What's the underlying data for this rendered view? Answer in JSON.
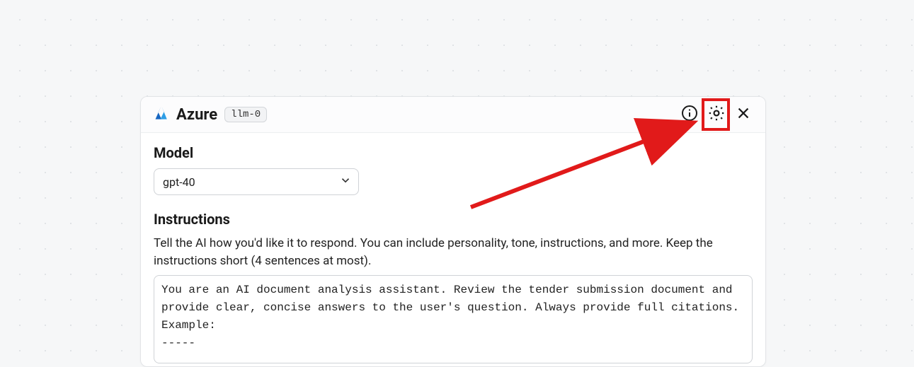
{
  "header": {
    "brand": "Azure",
    "tag": "llm-0"
  },
  "model": {
    "label": "Model",
    "selected": "gpt-40"
  },
  "instructions": {
    "label": "Instructions",
    "hint": "Tell the AI how you'd like it to respond. You can include personality, tone, instructions, and more. Keep the instructions short (4 sentences at most).",
    "value": "You are an AI document analysis assistant. Review the tender submission document and provide clear, concise answers to the user's question. Always provide full citations.\nExample:\n-----"
  },
  "icons": {
    "info": "info-icon",
    "gear": "gear-icon",
    "close": "close-icon",
    "azure": "azure-logo",
    "chevron": "chevron-down-icon"
  },
  "annotation": {
    "target": "settings-gear",
    "color": "#e11a1a"
  }
}
